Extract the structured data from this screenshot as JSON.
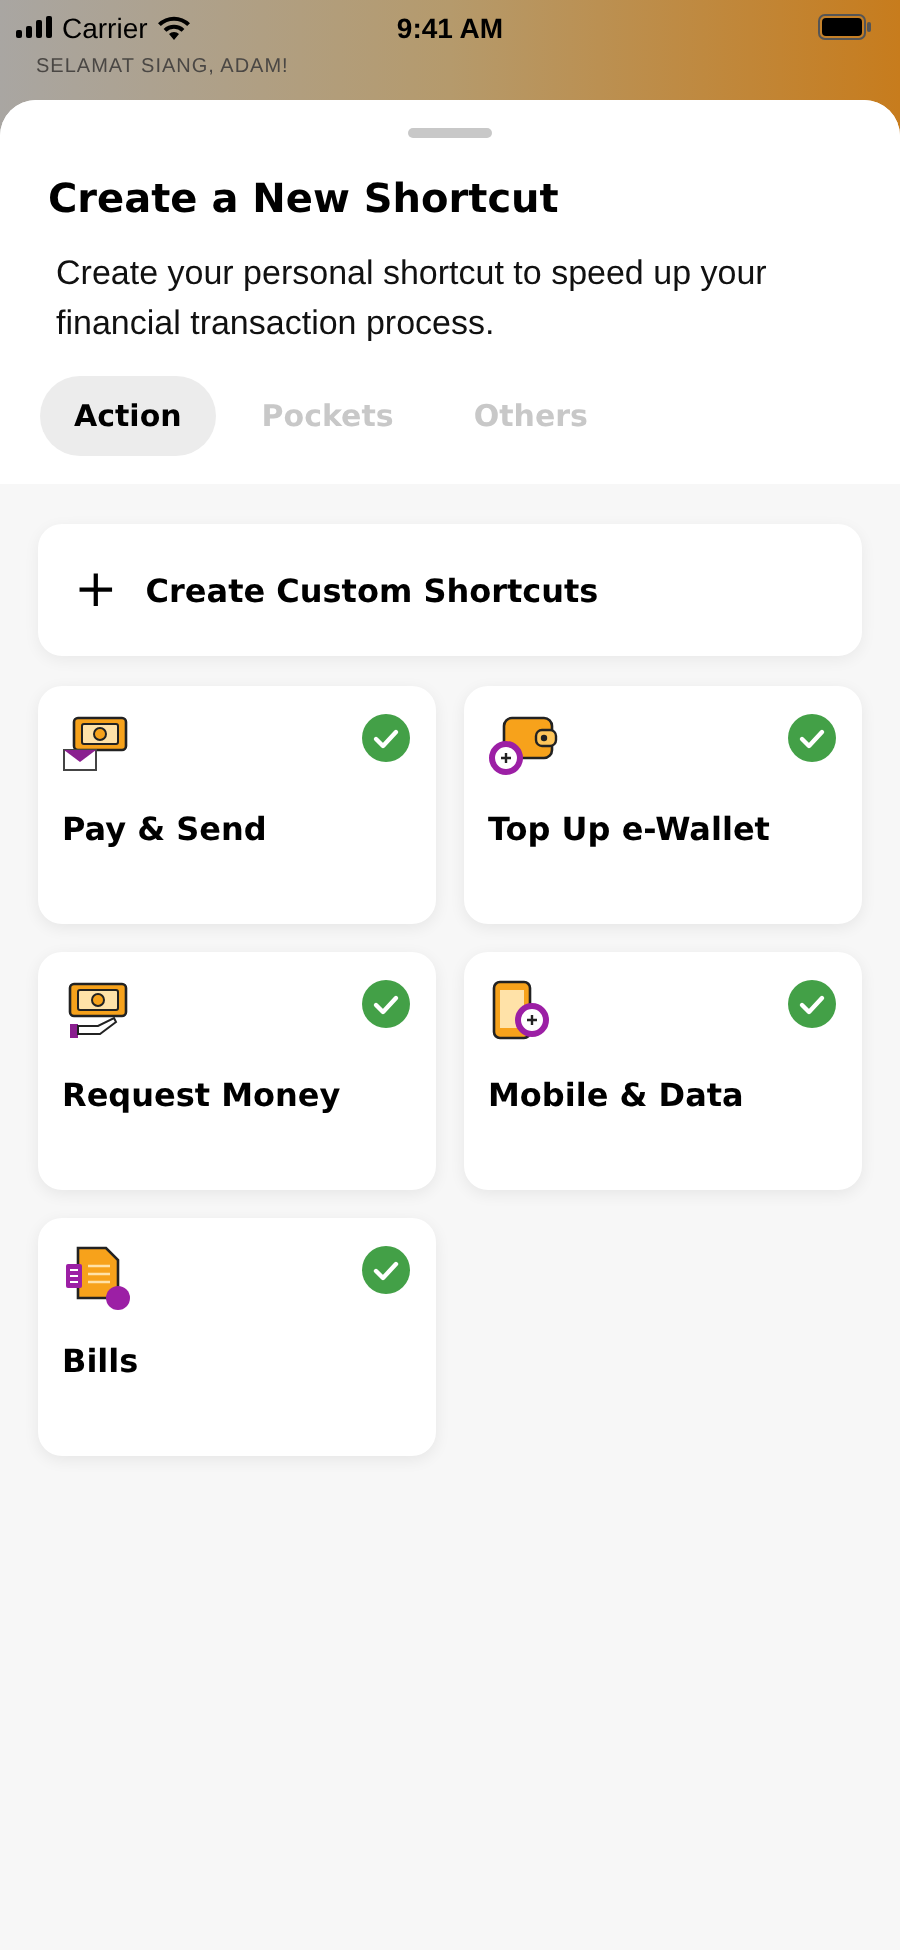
{
  "status_bar": {
    "carrier": "Carrier",
    "time": "9:41 AM"
  },
  "background": {
    "greeting": "SELAMAT SIANG, ADAM!"
  },
  "sheet": {
    "title": "Create a New Shortcut",
    "description": "Create your personal shortcut to speed up your financial transaction process.",
    "tabs": [
      {
        "label": "Action",
        "selected": true
      },
      {
        "label": "Pockets",
        "selected": false
      },
      {
        "label": "Others",
        "selected": false
      }
    ],
    "custom_button": {
      "icon": "+",
      "label": "Create Custom Shortcuts"
    },
    "shortcuts": [
      {
        "kind": "pay",
        "label": "Pay & Send",
        "checked": true
      },
      {
        "kind": "wallet",
        "label": "Top Up e-Wallet",
        "checked": true
      },
      {
        "kind": "request",
        "label": "Request Money",
        "checked": true
      },
      {
        "kind": "mobile",
        "label": "Mobile & Data",
        "checked": true
      },
      {
        "kind": "bills",
        "label": "Bills",
        "checked": true
      }
    ]
  }
}
